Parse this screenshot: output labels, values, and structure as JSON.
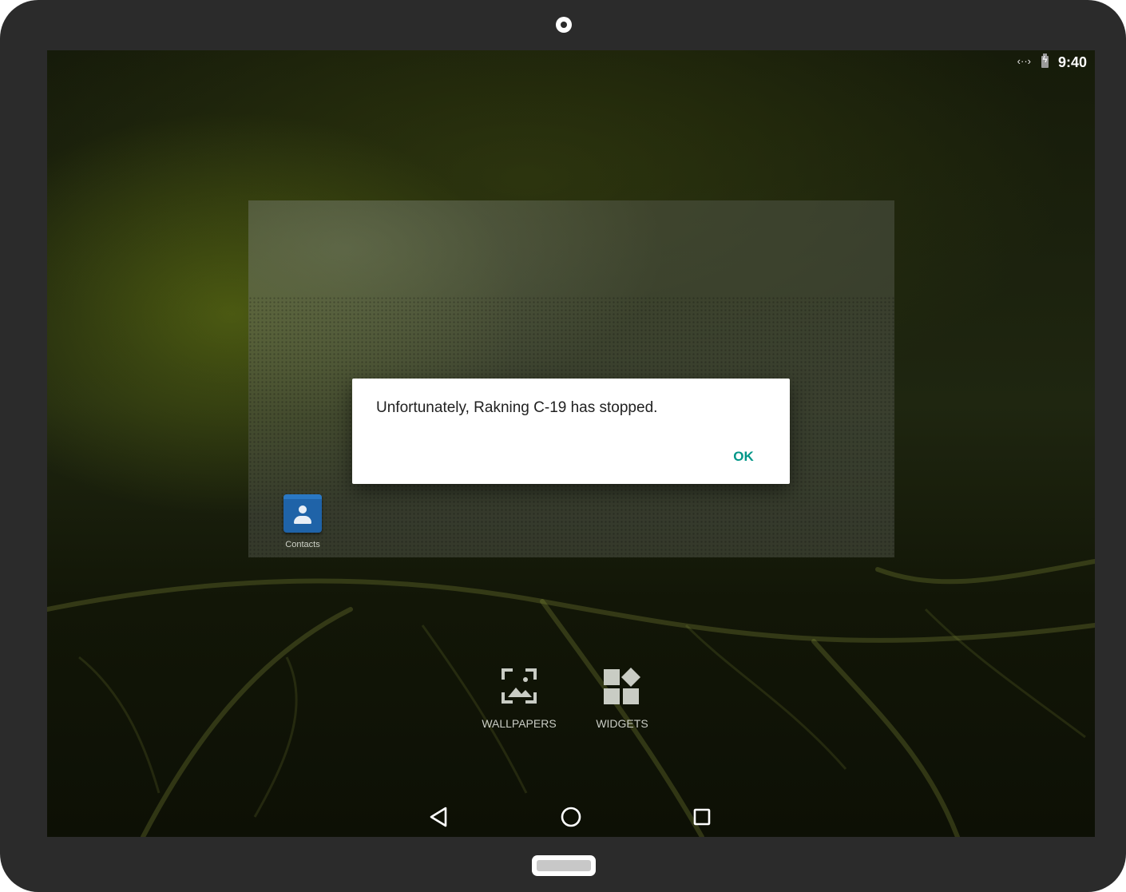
{
  "status_bar": {
    "data_icon": "data-transfer-icon",
    "battery_icon": "battery-charging-icon",
    "time": "9:40"
  },
  "folder": {
    "apps": [
      {
        "label": "Contacts",
        "icon": "contacts-icon"
      }
    ]
  },
  "dialog": {
    "message": "Unfortunately, Rakning C-19 has stopped.",
    "ok_label": "OK",
    "ok_color": "#009688"
  },
  "overview": {
    "wallpapers_label": "WALLPAPERS",
    "widgets_label": "WIDGETS"
  },
  "nav": {
    "back_icon": "back-icon",
    "home_icon": "home-icon",
    "recents_icon": "recents-icon"
  }
}
